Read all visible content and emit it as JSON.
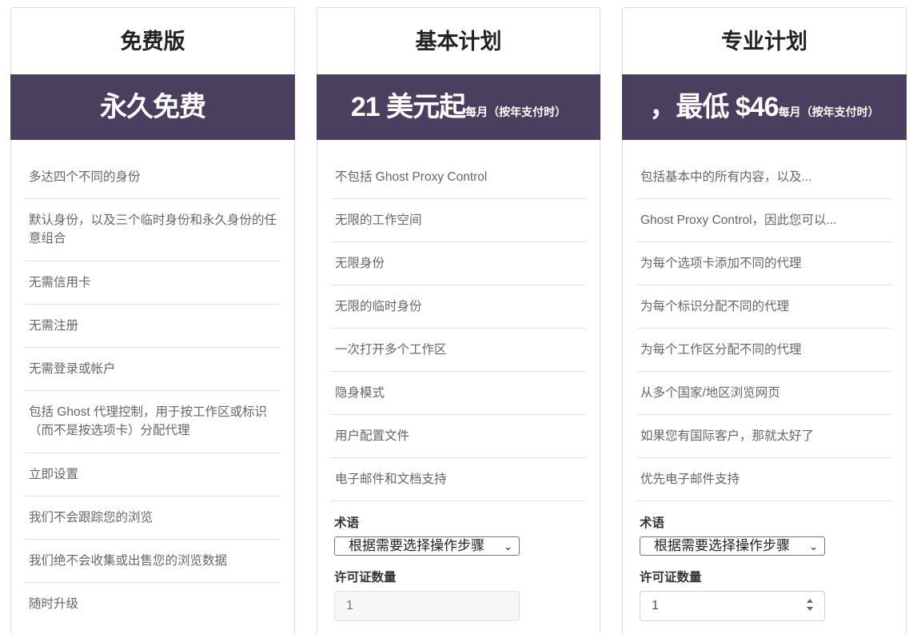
{
  "plans": {
    "free": {
      "title": "免费版",
      "price_main": "永久免费",
      "price_sub": "",
      "features": [
        "多达四个不同的身份",
        "默认身份，以及三个临时身份和永久身份的任意组合",
        "无需信用卡",
        "无需注册",
        "无需登录或帐户",
        "包括 Ghost 代理控制，用于按工作区或标识（而不是按选项卡）分配代理",
        "立即设置",
        "我们不会跟踪您的浏览",
        "我们绝不会收集或出售您的浏览数据",
        "随时升级"
      ]
    },
    "basic": {
      "title": "基本计划",
      "price_main": "21 美元起",
      "price_sub": "每月（按年支付时）",
      "features": [
        "不包括 Ghost Proxy Control",
        "无限的工作空间",
        "无限身份",
        "无限的临时身份",
        "一次打开多个工作区",
        "隐身模式",
        "用户配置文件",
        "电子邮件和文档支持"
      ],
      "term_label": "术语",
      "term_select": "根据需要选择操作步骤",
      "qty_label": "许可证数量",
      "qty_value": "1"
    },
    "pro": {
      "title": "专业计划",
      "price_main": "，最低 $46",
      "price_sub": "每月（按年支付时）",
      "features": [
        "包括基本中的所有内容，以及...",
        "Ghost Proxy Control，因此您可以...",
        "为每个选项卡添加不同的代理",
        "为每个标识分配不同的代理",
        "为每个工作区分配不同的代理",
        "从多个国家/地区浏览网页",
        "如果您有国际客户，那就太好了",
        "优先电子邮件支持"
      ],
      "term_label": "术语",
      "term_select": "根据需要选择操作步骤",
      "qty_label": "许可证数量",
      "qty_value": "1"
    }
  },
  "colors": {
    "price_band": "#4a3f5f",
    "border": "#dcdcdc",
    "feature_text": "#666666"
  }
}
